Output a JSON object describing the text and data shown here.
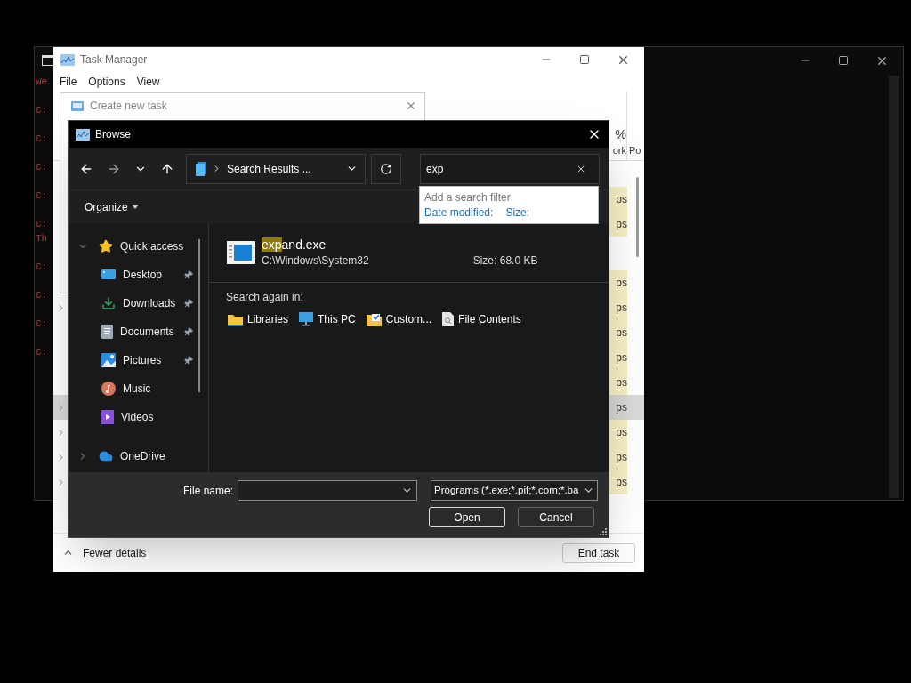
{
  "console": {
    "line_groups": [
      [
        "We"
      ],
      [
        "C:"
      ],
      [
        "C:"
      ],
      [
        "C:"
      ],
      [
        "C:"
      ],
      [
        "C:",
        "Th"
      ],
      [
        "C:"
      ],
      [
        "C:"
      ],
      [
        "C:"
      ],
      [
        "C:"
      ]
    ]
  },
  "task_manager": {
    "title": "Task Manager",
    "menu": [
      "File",
      "Options",
      "View"
    ],
    "column_headers": [
      {
        "top": "%",
        "bottom": "ork"
      },
      {
        "bottom": "Po"
      }
    ],
    "row_groups": [
      [
        {
          "text": "ps",
          "expandable": false,
          "selected": false
        },
        {
          "text": "ps",
          "expandable": false,
          "selected": false
        }
      ],
      [
        {
          "text": "ps",
          "expandable": false,
          "selected": false
        },
        {
          "text": "ps",
          "expandable": true,
          "selected": false
        },
        {
          "text": "ps",
          "expandable": false,
          "selected": false
        },
        {
          "text": "ps",
          "expandable": false,
          "selected": false
        },
        {
          "text": "ps",
          "expandable": false,
          "selected": false
        },
        {
          "text": "ps",
          "expandable": true,
          "selected": true
        },
        {
          "text": "ps",
          "expandable": true,
          "selected": false
        },
        {
          "text": "ps",
          "expandable": true,
          "selected": false
        },
        {
          "text": "ps",
          "expandable": true,
          "selected": false
        }
      ]
    ],
    "fewer_details": "Fewer details",
    "end_task": "End task"
  },
  "create_task": {
    "title": "Create new task"
  },
  "browse": {
    "title": "Browse",
    "address": "Search Results ...",
    "search": {
      "value": "exp"
    },
    "search_filter": {
      "heading": "Add a search filter",
      "filters": [
        "Date modified:",
        "Size:"
      ]
    },
    "organize": "Organize",
    "nav": [
      {
        "kind": "star",
        "label": "Quick access",
        "expanded": true,
        "children": [
          {
            "kind": "desktop",
            "label": "Desktop",
            "pinned": true
          },
          {
            "kind": "downloads",
            "label": "Downloads",
            "pinned": true
          },
          {
            "kind": "documents",
            "label": "Documents",
            "pinned": true
          },
          {
            "kind": "pictures",
            "label": "Pictures",
            "pinned": true
          },
          {
            "kind": "music",
            "label": "Music",
            "pinned": false
          },
          {
            "kind": "videos",
            "label": "Videos",
            "pinned": false
          }
        ]
      },
      {
        "kind": "cloud",
        "label": "OneDrive",
        "expanded": false
      }
    ],
    "result": {
      "name_match": "exp",
      "name_rest": "and.exe",
      "path": "C:\\Windows\\System32",
      "size": "Size: 68.0 KB"
    },
    "search_again_label": "Search again in:",
    "search_again": [
      {
        "kind": "folder",
        "label": "Libraries"
      },
      {
        "kind": "pc",
        "label": "This PC"
      },
      {
        "kind": "custom",
        "label": "Custom..."
      },
      {
        "kind": "file",
        "label": "File Contents"
      }
    ],
    "file_name_label": "File name:",
    "file_type": "Programs (*.exe;*.pif;*.com;*.ba",
    "open": "Open",
    "cancel": "Cancel"
  }
}
